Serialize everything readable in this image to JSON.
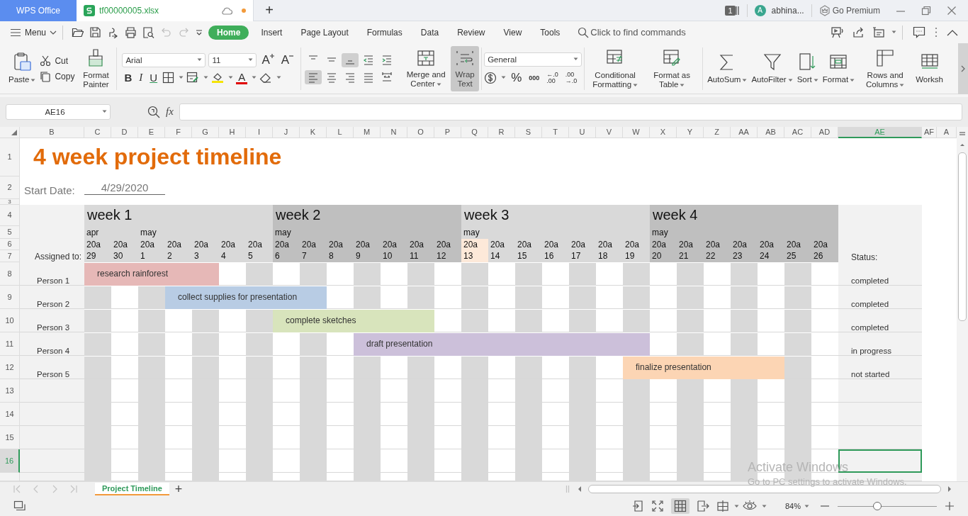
{
  "title_bar": {
    "app_tab": "WPS Office",
    "file_tab": {
      "name": "tf00000005.xlsx",
      "unsaved": true
    },
    "new_tab": "+",
    "window_count": "1",
    "user": {
      "initial": "A",
      "name": "abhina..."
    },
    "premium": "Go Premium"
  },
  "menu_bar": {
    "menu": "Menu",
    "tabs": [
      {
        "label": "Home",
        "selected": true
      },
      {
        "label": "Insert",
        "selected": false
      },
      {
        "label": "Page Layout",
        "selected": false
      },
      {
        "label": "Formulas",
        "selected": false
      },
      {
        "label": "Data",
        "selected": false
      },
      {
        "label": "Review",
        "selected": false
      },
      {
        "label": "View",
        "selected": false
      },
      {
        "label": "Tools",
        "selected": false
      }
    ],
    "search": {
      "placeholder": "Click to find commands"
    }
  },
  "ribbon": {
    "clipboard": [
      {
        "label": "Paste",
        "dropdown": true
      },
      {
        "label": "Cut",
        "dropdown": false
      },
      {
        "label": "Copy",
        "dropdown": false
      },
      {
        "label": "Format Painter",
        "dropdown": false
      }
    ],
    "font": {
      "name": "Arial",
      "size": "11",
      "grow": "A",
      "shrink": "A",
      "bold": "B",
      "italic": "I",
      "underline": "U",
      "font_color": "A"
    },
    "alignment": [
      {
        "selected": false
      },
      {
        "selected": false
      },
      {
        "selected": true
      },
      {
        "selected": false
      },
      {
        "selected": false
      },
      {
        "selected": true
      },
      {
        "selected": false
      },
      {
        "selected": false
      },
      {
        "selected": false
      },
      {
        "selected": false
      }
    ],
    "merge": [
      {
        "label": "Merge and Center",
        "dropdown": true,
        "selected": false
      },
      {
        "label": "Wrap Text",
        "dropdown": false,
        "selected": true
      }
    ],
    "number": {
      "format": "General",
      "percent": "%",
      "thousands": "000",
      "add_decimal": [
        "←.0",
        ".00"
      ],
      "remove_decimal": [
        ".00",
        "→.0"
      ]
    },
    "tools": [
      {
        "label": "Conditional Formatting",
        "dropdown": true
      },
      {
        "label": "Format as Table",
        "dropdown": true
      },
      {
        "label": "AutoSum",
        "dropdown": true
      },
      {
        "label": "AutoFilter",
        "dropdown": true
      },
      {
        "label": "Sort",
        "dropdown": true
      },
      {
        "label": "Format",
        "dropdown": true
      },
      {
        "label": "Rows and Columns",
        "dropdown": true
      },
      {
        "label": "Worksh",
        "dropdown": false
      }
    ]
  },
  "formula_bar": {
    "cell": "AE16",
    "fx": "fx"
  },
  "sheet": {
    "columns": [
      {
        "label": "B",
        "selected": false
      },
      {
        "label": "C",
        "selected": false
      },
      {
        "label": "D",
        "selected": false
      },
      {
        "label": "E",
        "selected": false
      },
      {
        "label": "F",
        "selected": false
      },
      {
        "label": "G",
        "selected": false
      },
      {
        "label": "H",
        "selected": false
      },
      {
        "label": "I",
        "selected": false
      },
      {
        "label": "J",
        "selected": false
      },
      {
        "label": "K",
        "selected": false
      },
      {
        "label": "L",
        "selected": false
      },
      {
        "label": "M",
        "selected": false
      },
      {
        "label": "N",
        "selected": false
      },
      {
        "label": "O",
        "selected": false
      },
      {
        "label": "P",
        "selected": false
      },
      {
        "label": "Q",
        "selected": false
      },
      {
        "label": "R",
        "selected": false
      },
      {
        "label": "S",
        "selected": false
      },
      {
        "label": "T",
        "selected": false
      },
      {
        "label": "U",
        "selected": false
      },
      {
        "label": "V",
        "selected": false
      },
      {
        "label": "W",
        "selected": false
      },
      {
        "label": "X",
        "selected": false
      },
      {
        "label": "Y",
        "selected": false
      },
      {
        "label": "Z",
        "selected": false
      },
      {
        "label": "AA",
        "selected": false
      },
      {
        "label": "AB",
        "selected": false
      },
      {
        "label": "AC",
        "selected": false
      },
      {
        "label": "AD",
        "selected": false
      },
      {
        "label": "AE",
        "selected": true
      },
      {
        "label": "AF",
        "selected": false
      },
      {
        "label": "A",
        "selected": false
      }
    ],
    "rows": [
      {
        "label": "1",
        "selected": false
      },
      {
        "label": "2",
        "selected": false
      },
      {
        "label": "3",
        "selected": false
      },
      {
        "label": "4",
        "selected": false
      },
      {
        "label": "5",
        "selected": false
      },
      {
        "label": "6",
        "selected": false
      },
      {
        "label": "7",
        "selected": false
      },
      {
        "label": "8",
        "selected": false
      },
      {
        "label": "9",
        "selected": false
      },
      {
        "label": "10",
        "selected": false
      },
      {
        "label": "11",
        "selected": false
      },
      {
        "label": "12",
        "selected": false
      },
      {
        "label": "13",
        "selected": false
      },
      {
        "label": "14",
        "selected": false
      },
      {
        "label": "15",
        "selected": false
      },
      {
        "label": "16",
        "selected": true
      }
    ],
    "title": "4 week project timeline",
    "start_date": {
      "label": "Start Date:",
      "value": "4/29/2020"
    },
    "assigned_label": "Assigned to:",
    "status_label": "Status:",
    "weeks": [
      {
        "label": "week 1",
        "color": "#d9d9d9"
      },
      {
        "label": "week 2",
        "color": "#bfbfbf"
      },
      {
        "label": "week 3",
        "color": "#d9d9d9"
      },
      {
        "label": "week 4",
        "color": "#bfbfbf"
      }
    ],
    "days": [
      {
        "month": "apr",
        "prefix": "20a",
        "date": "29",
        "shaded": true,
        "highlighted": false
      },
      {
        "prefix": "20a",
        "date": "30",
        "shaded": false,
        "highlighted": false
      },
      {
        "month": "may",
        "prefix": "20a",
        "date": "1",
        "shaded": true,
        "highlighted": false
      },
      {
        "prefix": "20a",
        "date": "2",
        "shaded": false,
        "highlighted": false
      },
      {
        "prefix": "20a",
        "date": "3",
        "shaded": true,
        "highlighted": false
      },
      {
        "prefix": "20a",
        "date": "4",
        "shaded": false,
        "highlighted": false
      },
      {
        "prefix": "20a",
        "date": "5",
        "shaded": true,
        "highlighted": false
      },
      {
        "month": "may",
        "prefix": "20a",
        "date": "6",
        "shaded": false,
        "highlighted": false
      },
      {
        "prefix": "20a",
        "date": "7",
        "shaded": true,
        "highlighted": false
      },
      {
        "prefix": "20a",
        "date": "8",
        "shaded": false,
        "highlighted": false
      },
      {
        "prefix": "20a",
        "date": "9",
        "shaded": true,
        "highlighted": false
      },
      {
        "prefix": "20a",
        "date": "10",
        "shaded": false,
        "highlighted": false
      },
      {
        "prefix": "20a",
        "date": "11",
        "shaded": true,
        "highlighted": false
      },
      {
        "prefix": "20a",
        "date": "12",
        "shaded": false,
        "highlighted": false
      },
      {
        "month": "may",
        "prefix": "20a",
        "date": "13",
        "shaded": true,
        "highlighted": true
      },
      {
        "prefix": "20a",
        "date": "14",
        "shaded": false,
        "highlighted": false
      },
      {
        "prefix": "20a",
        "date": "15",
        "shaded": true,
        "highlighted": false
      },
      {
        "prefix": "20a",
        "date": "16",
        "shaded": false,
        "highlighted": false
      },
      {
        "prefix": "20a",
        "date": "17",
        "shaded": true,
        "highlighted": false
      },
      {
        "prefix": "20a",
        "date": "18",
        "shaded": false,
        "highlighted": false
      },
      {
        "prefix": "20a",
        "date": "19",
        "shaded": true,
        "highlighted": false
      },
      {
        "month": "may",
        "prefix": "20a",
        "date": "20",
        "shaded": false,
        "highlighted": false
      },
      {
        "prefix": "20a",
        "date": "21",
        "shaded": true,
        "highlighted": false
      },
      {
        "prefix": "20a",
        "date": "22",
        "shaded": false,
        "highlighted": false
      },
      {
        "prefix": "20a",
        "date": "23",
        "shaded": true,
        "highlighted": false
      },
      {
        "prefix": "20a",
        "date": "24",
        "shaded": false,
        "highlighted": false
      },
      {
        "prefix": "20a",
        "date": "25",
        "shaded": true,
        "highlighted": false
      },
      {
        "prefix": "20a",
        "date": "26",
        "shaded": false,
        "highlighted": false
      }
    ],
    "tasks": [
      {
        "person": "Person 1",
        "task": "research rainforest",
        "color": "#e6b8b7",
        "status": "completed",
        "days": [
          true,
          true,
          true,
          true,
          true,
          false,
          false,
          false,
          false,
          false,
          false,
          false,
          false,
          false,
          false,
          false,
          false,
          false,
          false,
          false,
          false,
          false,
          false,
          false,
          false,
          false,
          false,
          false
        ]
      },
      {
        "person": "Person 2",
        "task": "collect supplies for presentation",
        "color": "#b8cce4",
        "status": "completed",
        "days": [
          false,
          false,
          false,
          true,
          true,
          true,
          true,
          true,
          true,
          false,
          false,
          false,
          false,
          false,
          false,
          false,
          false,
          false,
          false,
          false,
          false,
          false,
          false,
          false,
          false,
          false,
          false,
          false
        ]
      },
      {
        "person": "Person 3",
        "task": "complete sketches",
        "color": "#d8e4bc",
        "status": "completed",
        "days": [
          false,
          false,
          false,
          false,
          false,
          false,
          false,
          true,
          true,
          true,
          true,
          true,
          true,
          false,
          false,
          false,
          false,
          false,
          false,
          false,
          false,
          false,
          false,
          false,
          false,
          false,
          false,
          false
        ]
      },
      {
        "person": "Person 4",
        "task": "draft presentation",
        "color": "#ccc0da",
        "status": "in progress",
        "days": [
          false,
          false,
          false,
          false,
          false,
          false,
          false,
          false,
          false,
          false,
          true,
          true,
          true,
          true,
          true,
          true,
          true,
          true,
          true,
          true,
          true,
          false,
          false,
          false,
          false,
          false,
          false,
          false
        ]
      },
      {
        "person": "Person 5",
        "task": "finalize presentation",
        "color": "#fcd5b4",
        "status": "not started",
        "days": [
          false,
          false,
          false,
          false,
          false,
          false,
          false,
          false,
          false,
          false,
          false,
          false,
          false,
          false,
          false,
          false,
          false,
          false,
          false,
          false,
          true,
          true,
          true,
          true,
          true,
          true,
          false,
          false
        ]
      }
    ]
  },
  "sheet_tabs": [
    {
      "label": "Project Timeline",
      "selected": true
    }
  ],
  "new_sheet": "+",
  "status_bar": {
    "zoom": "84%",
    "zoom_slider": {
      "level": 0.4
    }
  },
  "os_notice": {
    "title": "Activate Windows",
    "text": "Go to PC settings to activate Windows."
  }
}
